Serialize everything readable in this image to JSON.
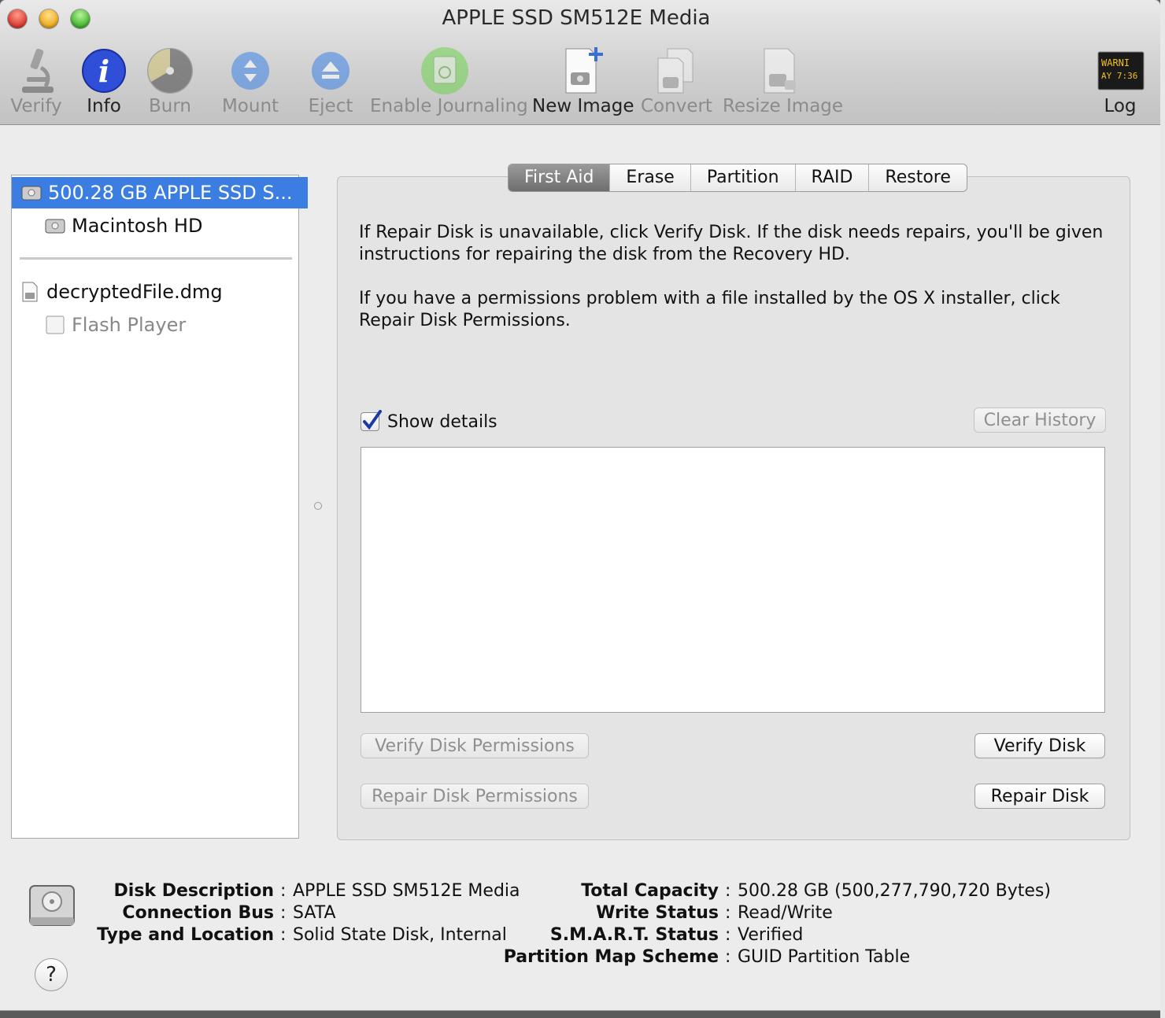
{
  "window": {
    "title": "APPLE SSD SM512E Media"
  },
  "toolbar": {
    "items": [
      {
        "label": "Verify",
        "icon": "microscope-icon",
        "enabled": false
      },
      {
        "label": "Info",
        "icon": "info-icon",
        "enabled": true
      },
      {
        "label": "Burn",
        "icon": "burn-icon",
        "enabled": false
      },
      {
        "label": "Mount",
        "icon": "mount-icon",
        "enabled": false
      },
      {
        "label": "Eject",
        "icon": "eject-icon",
        "enabled": false
      },
      {
        "label": "Enable Journaling",
        "icon": "journaling-icon",
        "enabled": false
      },
      {
        "label": "New Image",
        "icon": "new-image-icon",
        "enabled": true
      },
      {
        "label": "Convert",
        "icon": "convert-icon",
        "enabled": false
      },
      {
        "label": "Resize Image",
        "icon": "resize-image-icon",
        "enabled": false
      }
    ],
    "log": {
      "label": "Log",
      "icon": "log-console-icon",
      "screen_text_1": "WARNI",
      "screen_text_2": "AY 7:36"
    }
  },
  "sidebar": {
    "items": [
      {
        "label": "500.28 GB APPLE SSD S...",
        "icon": "hard-disk-icon",
        "selected": true
      },
      {
        "label": "Macintosh HD",
        "icon": "volume-icon"
      },
      {
        "label": "decryptedFile.dmg",
        "icon": "disk-image-file-icon"
      },
      {
        "label": "Flash Player",
        "icon": "unmounted-volume-icon",
        "dimmed": true
      }
    ]
  },
  "tabs": [
    {
      "label": "First Aid",
      "active": true
    },
    {
      "label": "Erase"
    },
    {
      "label": "Partition"
    },
    {
      "label": "RAID"
    },
    {
      "label": "Restore"
    }
  ],
  "firstaid": {
    "para1": "If Repair Disk is unavailable, click Verify Disk. If the disk needs repairs, you'll be given instructions for repairing the disk from the Recovery HD.",
    "para2": "If you have a permissions problem with a file installed by the OS X installer, click Repair Disk Permissions.",
    "show_details": "Show details",
    "show_details_checked": true,
    "clear_history": "Clear History",
    "verify_permissions": "Verify Disk Permissions",
    "repair_permissions": "Repair Disk Permissions",
    "verify_disk": "Verify Disk",
    "repair_disk": "Repair Disk"
  },
  "info": {
    "left": [
      {
        "key": "Disk Description",
        "value": "APPLE SSD SM512E Media"
      },
      {
        "key": "Connection Bus",
        "value": "SATA"
      },
      {
        "key": "Type and Location",
        "value": "Solid State Disk, Internal"
      }
    ],
    "right": [
      {
        "key": "Total Capacity",
        "value": "500.28 GB (500,277,790,720 Bytes)"
      },
      {
        "key": "Write Status",
        "value": "Read/Write"
      },
      {
        "key": "S.M.A.R.T. Status",
        "value": "Verified"
      },
      {
        "key": "Partition Map Scheme",
        "value": "GUID Partition Table"
      }
    ],
    "separator": ":",
    "help": "?"
  }
}
